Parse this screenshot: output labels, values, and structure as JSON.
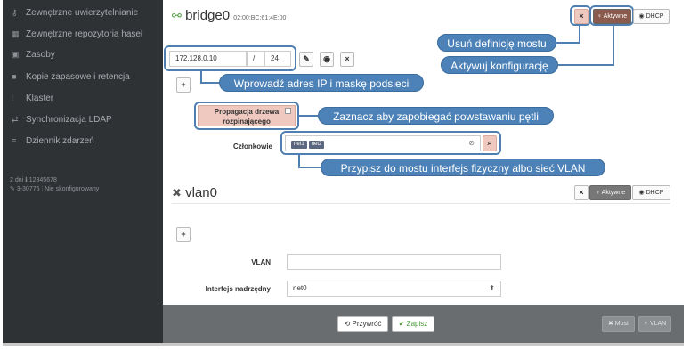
{
  "sidebar": {
    "items": [
      {
        "icon": "key-icon",
        "glyph": "⚷",
        "label": "Zewnętrzne uwierzytelnianie"
      },
      {
        "icon": "grid-icon",
        "glyph": "▦",
        "label": "Zewnętrzne repozytoria haseł"
      },
      {
        "icon": "image-icon",
        "glyph": "▣",
        "label": "Zasoby"
      },
      {
        "icon": "archive-icon",
        "glyph": "■",
        "label": "Kopie zapasowe i retencja"
      },
      {
        "icon": "cluster-icon",
        "glyph": "⫶",
        "label": "Klaster"
      },
      {
        "icon": "sync-icon",
        "glyph": "⇄",
        "label": "Synchronizacja LDAP"
      },
      {
        "icon": "list-icon",
        "glyph": "≡",
        "label": "Dziennik zdarzeń"
      }
    ],
    "info_line1": "2 dni   ℹ 12345678",
    "info_line2": "✎ 3-30775   ⫶ Nie skonfigurowany"
  },
  "bridge": {
    "name": "bridge0",
    "mac": "02:00:BC:61:4E:00",
    "remove_label": "×",
    "active_label": "♀ Aktywne",
    "dhcp_label": "◉ DHCP",
    "ip_value": "172.128.0.10",
    "slash": "/",
    "mask_value": "24",
    "wrench_label": "✎",
    "globe_label": "◉",
    "clear_label": "×",
    "add_label": "+",
    "stp_label_line1": "Propagacja drzewa",
    "stp_label_line2": "rozpinającego",
    "members_label": "Członkowie",
    "members": [
      "net1",
      "net2"
    ]
  },
  "callouts": {
    "remove": "Usuń definicję mostu",
    "activate": "Aktywuj konfigurację",
    "ip": "Wprowadź adres IP i maskę podsieci",
    "stp": "Zaznacz aby zapobiegać powstawaniu pętli",
    "members": "Przypisz do mostu interfejs fizyczny albo sieć VLAN"
  },
  "vlan": {
    "name": "vlan0",
    "remove_label": "×",
    "active_label": "♀ Aktywne",
    "dhcp_label": "◉ DHCP",
    "add_label": "+",
    "vlan_label": "VLAN",
    "vlan_value": "",
    "parent_label": "Interfejs nadrzędny",
    "parent_value": "net0"
  },
  "footer": {
    "restore_label": "⟲ Przywróć",
    "save_label": "✔ Zapisz",
    "bridge_label": "✖ Most",
    "vlan_label": "♆ VLAN"
  },
  "colors": {
    "sidebar": "#2f3235",
    "highlight": "#efc9bf",
    "callout": "#4d82b8",
    "footer": "#6a6d70",
    "save_green": "#4a9c3a"
  }
}
